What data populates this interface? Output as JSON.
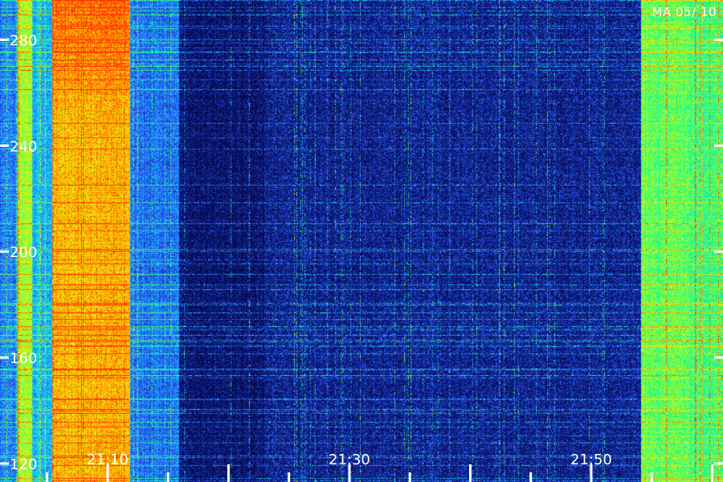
{
  "station_label": "MA 05/ 10",
  "chart_data": {
    "type": "heatmap",
    "title": "",
    "xlabel": "",
    "ylabel": "",
    "x_tick_labels": [
      "21:10",
      "21:30",
      "21:50"
    ],
    "x_ticks_minutes_after_2100": [
      10,
      30,
      50
    ],
    "xlim_minutes_after_2100": [
      1.1,
      60.9
    ],
    "y_tick_labels": [
      "120",
      "160",
      "200",
      "240",
      "280"
    ],
    "y_ticks": [
      120,
      160,
      200,
      240,
      280
    ],
    "ylim": [
      113,
      295
    ],
    "colormap": [
      "#000030",
      "#10208a",
      "#2c5cff",
      "#10d8ff",
      "#20ff70",
      "#c8ff20",
      "#ffd000",
      "#ff3000"
    ],
    "intensity_bands": [
      {
        "from_min": 1.1,
        "to_min": 2.5,
        "level": 0.32
      },
      {
        "from_min": 2.5,
        "to_min": 3.7,
        "level": 0.7
      },
      {
        "from_min": 3.7,
        "to_min": 5.4,
        "level": 0.4
      },
      {
        "from_min": 5.4,
        "to_min": 11.8,
        "level": 0.86
      },
      {
        "from_min": 11.8,
        "to_min": 15.9,
        "level": 0.3
      },
      {
        "from_min": 15.9,
        "to_min": 22.9,
        "level": 0.14
      },
      {
        "from_min": 22.9,
        "to_min": 54.1,
        "level": 0.2
      },
      {
        "from_min": 54.1,
        "to_min": 58.0,
        "level": 0.62
      },
      {
        "from_min": 58.0,
        "to_min": 60.9,
        "level": 0.58
      }
    ]
  }
}
